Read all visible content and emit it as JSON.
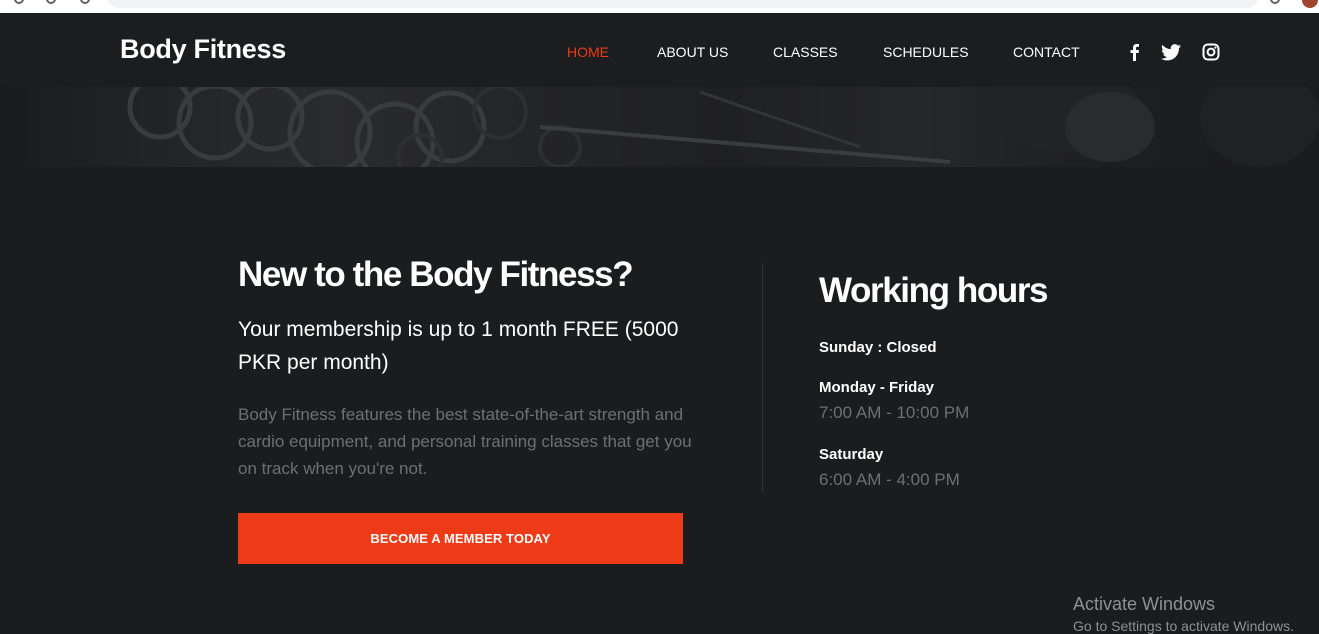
{
  "header": {
    "brand": "Body Fitness",
    "nav": [
      {
        "label": "HOME",
        "active": true
      },
      {
        "label": "ABOUT US",
        "active": false
      },
      {
        "label": "CLASSES",
        "active": false
      },
      {
        "label": "SCHEDULES",
        "active": false
      },
      {
        "label": "CONTACT",
        "active": false
      }
    ],
    "social_icons": [
      "facebook-icon",
      "twitter-icon",
      "instagram-icon"
    ]
  },
  "intro": {
    "title": "New to the Body Fitness?",
    "subtitle": "Your membership is up to 1 month FREE (5000 PKR per month)",
    "description": "Body Fitness features the best state-of-the-art strength and cardio equipment, and personal training classes that get you on track when you're not.",
    "cta_label": "BECOME A MEMBER TODAY"
  },
  "working_hours": {
    "title": "Working hours",
    "entries": [
      {
        "label": "Sunday : Closed",
        "time": ""
      },
      {
        "label": "Monday - Friday",
        "time": "7:00 AM - 10:00 PM"
      },
      {
        "label": "Saturday",
        "time": "6:00 AM - 4:00 PM"
      }
    ]
  },
  "watermark": {
    "title": "Activate Windows",
    "subtitle": "Go to Settings to activate Windows."
  },
  "colors": {
    "accent": "#ef3a17",
    "background": "#1b1c1e",
    "muted_text": "#6e6f72"
  }
}
